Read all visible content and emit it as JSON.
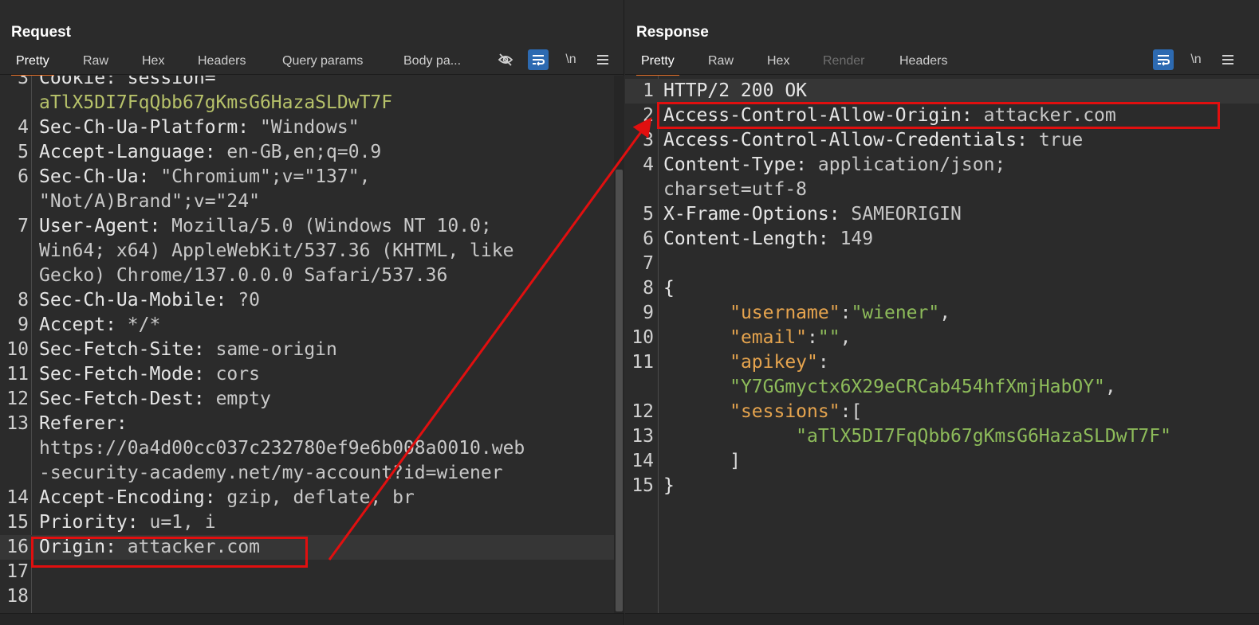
{
  "request": {
    "title": "Request",
    "tabs": [
      "Pretty",
      "Raw",
      "Hex",
      "Headers",
      "Query params",
      "Body pa..."
    ],
    "active_tab": "Pretty",
    "tools": {
      "newline_label": "\\n"
    },
    "lines": [
      {
        "n": "3",
        "a": "Cookie: session=",
        "b": "",
        "cls": "k",
        "partial": true
      },
      {
        "n": "",
        "a": "aTlX5DI7FqQbb67gKmsG6HazaSLDwT7F",
        "b": "",
        "cls": "g"
      },
      {
        "n": "4",
        "a": "Sec-Ch-Ua-Platform: ",
        "b": "\"Windows\""
      },
      {
        "n": "5",
        "a": "Accept-Language: ",
        "b": "en-GB,en;q=0.9"
      },
      {
        "n": "6",
        "a": "Sec-Ch-Ua: ",
        "b": "\"Chromium\";v=\"137\","
      },
      {
        "n": "",
        "a": "",
        "b": "\"Not/A)Brand\";v=\"24\""
      },
      {
        "n": "7",
        "a": "User-Agent: ",
        "b": "Mozilla/5.0 (Windows NT 10.0;"
      },
      {
        "n": "",
        "a": "",
        "b": "Win64; x64) AppleWebKit/537.36 (KHTML, like"
      },
      {
        "n": "",
        "a": "",
        "b": "Gecko) Chrome/137.0.0.0 Safari/537.36"
      },
      {
        "n": "8",
        "a": "Sec-Ch-Ua-Mobile: ",
        "b": "?0"
      },
      {
        "n": "9",
        "a": "Accept: ",
        "b": "*/*"
      },
      {
        "n": "10",
        "a": "Sec-Fetch-Site: ",
        "b": "same-origin"
      },
      {
        "n": "11",
        "a": "Sec-Fetch-Mode: ",
        "b": "cors"
      },
      {
        "n": "12",
        "a": "Sec-Fetch-Dest: ",
        "b": "empty"
      },
      {
        "n": "13",
        "a": "Referer:",
        "b": ""
      },
      {
        "n": "",
        "a": "",
        "b": "https://0a4d00cc037c232780ef9e6b008a0010.web"
      },
      {
        "n": "",
        "a": "",
        "b": "-security-academy.net/my-account?id=wiener"
      },
      {
        "n": "14",
        "a": "Accept-Encoding: ",
        "b": "gzip, deflate, br"
      },
      {
        "n": "15",
        "a": "Priority: ",
        "b": "u=1, i"
      },
      {
        "n": "16",
        "a": "Origin: ",
        "b": "attacker.com",
        "highlight": true
      },
      {
        "n": "17",
        "a": "",
        "b": ""
      },
      {
        "n": "18",
        "a": "",
        "b": ""
      }
    ]
  },
  "response": {
    "title": "Response",
    "tabs": [
      "Pretty",
      "Raw",
      "Hex",
      "Render",
      "Headers"
    ],
    "active_tab": "Pretty",
    "disabled_tab": "Render",
    "tools": {
      "newline_label": "\\n"
    },
    "lines": [
      {
        "n": "1",
        "a": "HTTP/2 200 OK",
        "b": "",
        "highlight": true
      },
      {
        "n": "2",
        "a": "Access-Control-Allow-Origin: ",
        "b": "attacker.com"
      },
      {
        "n": "3",
        "a": "Access-Control-Allow-Credentials: ",
        "b": "true"
      },
      {
        "n": "4",
        "a": "Content-Type: ",
        "b": "application/json;"
      },
      {
        "n": "",
        "a": "",
        "b": "charset=utf-8"
      },
      {
        "n": "5",
        "a": "X-Frame-Options: ",
        "b": "SAMEORIGIN"
      },
      {
        "n": "6",
        "a": "Content-Length: ",
        "b": "149"
      },
      {
        "n": "7",
        "a": "",
        "b": ""
      },
      {
        "n": "8",
        "a": "{",
        "b": ""
      },
      {
        "n": "9",
        "json": [
          [
            "      ",
            "p"
          ],
          [
            "\"username\"",
            "s"
          ],
          [
            ":",
            "p"
          ],
          [
            "\"wiener\"",
            "str"
          ],
          [
            ",",
            "p"
          ]
        ]
      },
      {
        "n": "10",
        "json": [
          [
            "      ",
            "p"
          ],
          [
            "\"email\"",
            "s"
          ],
          [
            ":",
            "p"
          ],
          [
            "\"\"",
            "str"
          ],
          [
            ",",
            "p"
          ]
        ]
      },
      {
        "n": "11",
        "json": [
          [
            "      ",
            "p"
          ],
          [
            "\"apikey\"",
            "s"
          ],
          [
            ":",
            "p"
          ]
        ]
      },
      {
        "n": "",
        "json": [
          [
            "      ",
            "p"
          ],
          [
            "\"Y7GGmyctx6X29eCRCab454hfXmjHabOY\"",
            "str"
          ],
          [
            ",",
            "p"
          ]
        ]
      },
      {
        "n": "12",
        "json": [
          [
            "      ",
            "p"
          ],
          [
            "\"sessions\"",
            "s"
          ],
          [
            ":[",
            "p"
          ]
        ]
      },
      {
        "n": "13",
        "json": [
          [
            "            ",
            "p"
          ],
          [
            "\"aTlX5DI7FqQbb67gKmsG6HazaSLDwT7F\"",
            "str"
          ]
        ]
      },
      {
        "n": "14",
        "json": [
          [
            "      ",
            "p"
          ],
          [
            "]",
            "p"
          ]
        ]
      },
      {
        "n": "15",
        "a": "}",
        "b": ""
      }
    ]
  },
  "colors": {
    "background": "#2b2b2b",
    "accent_tab_underline": "#e8722a",
    "toggle_on": "#2d6ab1",
    "annotation_red": "#e10f0f"
  },
  "icons": [
    "hide-icon",
    "wrap-lines-icon",
    "newline-icon",
    "menu-icon",
    "layout-split-icon",
    "layout-rows-icon",
    "layout-single-icon"
  ]
}
